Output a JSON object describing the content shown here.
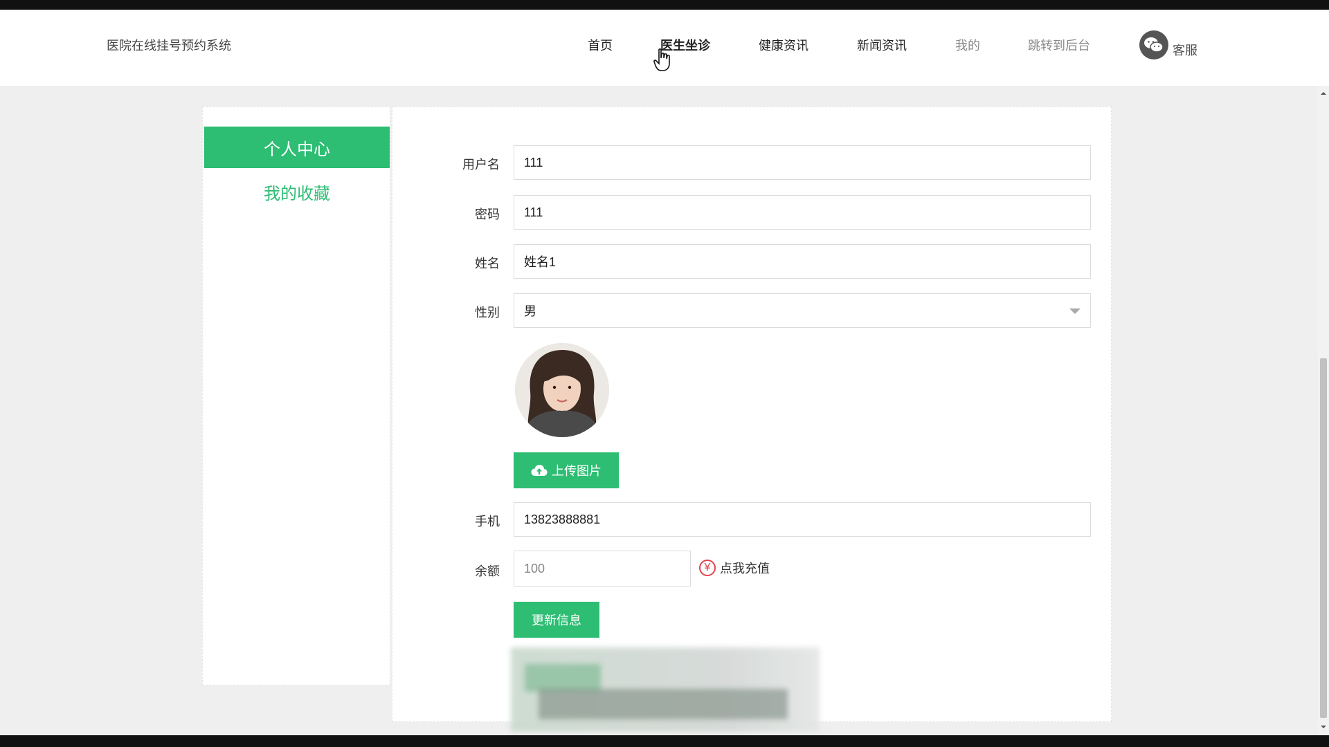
{
  "header": {
    "brand": "医院在线挂号预约系统",
    "nav": [
      "首页",
      "医生坐诊",
      "健康资讯",
      "新闻资讯",
      "我的",
      "跳转到后台"
    ],
    "service_label": "客服"
  },
  "sidebar": {
    "active_label": "个人中心",
    "link_label": "我的收藏"
  },
  "form": {
    "username_label": "用户名",
    "username_value": "111",
    "password_label": "密码",
    "password_value": "111",
    "name_label": "姓名",
    "name_value": "姓名1",
    "gender_label": "性别",
    "gender_value": "男",
    "upload_label": "上传图片",
    "phone_label": "手机",
    "phone_value": "13823888881",
    "balance_label": "余额",
    "balance_value": "100",
    "recharge_symbol": "¥",
    "recharge_label": "点我充值",
    "update_label": "更新信息"
  },
  "colors": {
    "accent": "#2dbd73",
    "recharge_icon": "#e0444a"
  },
  "icons": [
    "wechat-icon",
    "hand-cursor-icon",
    "cloud-upload-icon",
    "yen-icon",
    "chevron-down-icon"
  ]
}
